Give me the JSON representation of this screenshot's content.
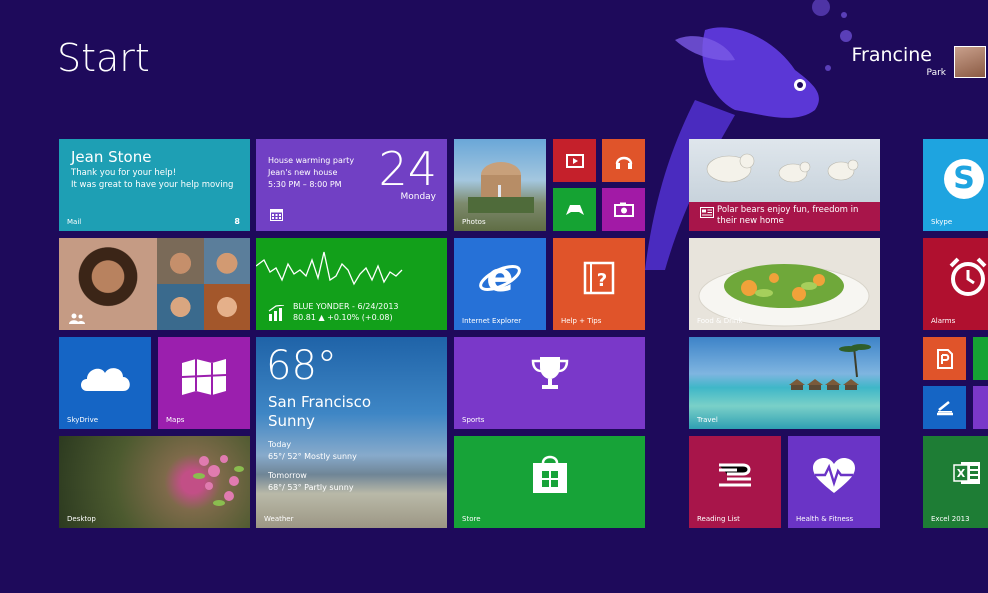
{
  "screen": {
    "title": "Start"
  },
  "user": {
    "first_name": "Francine",
    "last_name": "Park"
  },
  "colors": {
    "background": "#1e0a5b",
    "mail": "#1e9fb4",
    "calendar": "#7140c4",
    "finance": "#12a01a",
    "ie": "#2671d7",
    "help": "#e0542a",
    "sports": "#7a38c9",
    "store": "#17a338",
    "skydrive": "#1565c5",
    "maps": "#9b1fae",
    "news": "#a8154a",
    "reading_list": "#a8154a",
    "health": "#6a34c6",
    "skype": "#1ea4e0",
    "alarms": "#b0102f",
    "excel": "#1e7d35"
  },
  "tiles": {
    "mail": {
      "label": "Mail",
      "from": "Jean Stone",
      "line1": "Thank you for your help!",
      "line2": "It was great to have your help moving",
      "count": "8"
    },
    "calendar": {
      "line1": "House warming party",
      "line2": "Jean's new house",
      "line3": "5:30 PM – 8:00 PM",
      "date_number": "24",
      "weekday": "Monday"
    },
    "photos": {
      "label": "Photos"
    },
    "people": {
      "label": "People"
    },
    "finance": {
      "line1": "BLUE YONDER - 6/24/2013",
      "line2": "80.81 ▲ +0.10% (+0.08)"
    },
    "internet_explorer": {
      "label": "Internet Explorer"
    },
    "help_tips": {
      "label": "Help + Tips"
    },
    "skydrive": {
      "label": "SkyDrive"
    },
    "maps": {
      "label": "Maps"
    },
    "weather": {
      "label": "Weather",
      "temperature": "68°",
      "city": "San Francisco",
      "condition": "Sunny",
      "today_label": "Today",
      "today_forecast": "65°/ 52° Mostly sunny",
      "tomorrow_label": "Tomorrow",
      "tomorrow_forecast": "68°/ 53° Partly sunny"
    },
    "sports": {
      "label": "Sports"
    },
    "desktop": {
      "label": "Desktop"
    },
    "store": {
      "label": "Store"
    },
    "news": {
      "headline_line1": "Polar bears enjoy fun, freedom in",
      "headline_line2": "their new home"
    },
    "food_drink": {
      "label": "Food & Drink"
    },
    "travel": {
      "label": "Travel"
    },
    "reading_list": {
      "label": "Reading List"
    },
    "health_fitness": {
      "label": "Health & Fitness"
    },
    "skype": {
      "label": "Skype"
    },
    "alarms": {
      "label": "Alarms"
    },
    "excel": {
      "label": "Excel 2013"
    }
  }
}
